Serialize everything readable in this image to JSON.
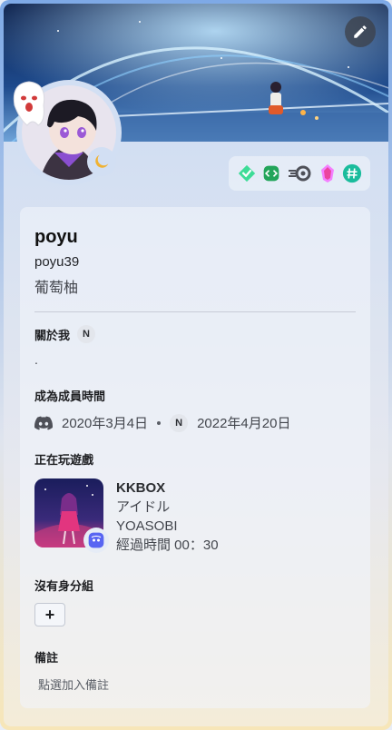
{
  "colors": {
    "accent": "#5865f2",
    "badge_green": "#23a55a",
    "badge_teal": "#1abc9c",
    "badge_pink": "#eb459e",
    "moon": "#f0b232"
  },
  "header": {
    "edit_icon": "pencil-icon"
  },
  "badges": [
    {
      "icon": "hypesquad-balance-icon"
    },
    {
      "icon": "active-developer-icon"
    },
    {
      "icon": "nitro-boost-icon"
    },
    {
      "icon": "crystal-boost-icon"
    },
    {
      "icon": "hashtag-icon"
    }
  ],
  "profile": {
    "display_name": "poyu",
    "username": "poyu39",
    "pronouns": "葡萄柚"
  },
  "about": {
    "title": "關於我",
    "server_tag": "N",
    "text": "."
  },
  "member_since": {
    "title": "成為成員時間",
    "discord_date": "2020年3月4日",
    "server_tag": "N",
    "server_date": "2022年4月20日"
  },
  "activity": {
    "title": "正在玩遊戲",
    "app_name": "KKBOX",
    "song": "アイドル",
    "artist": "YOASOBI",
    "elapsed": "經過時間 00：30"
  },
  "roles": {
    "title": "沒有身分組",
    "add_label": "+"
  },
  "note": {
    "title": "備註",
    "placeholder": "點選加入備註"
  }
}
